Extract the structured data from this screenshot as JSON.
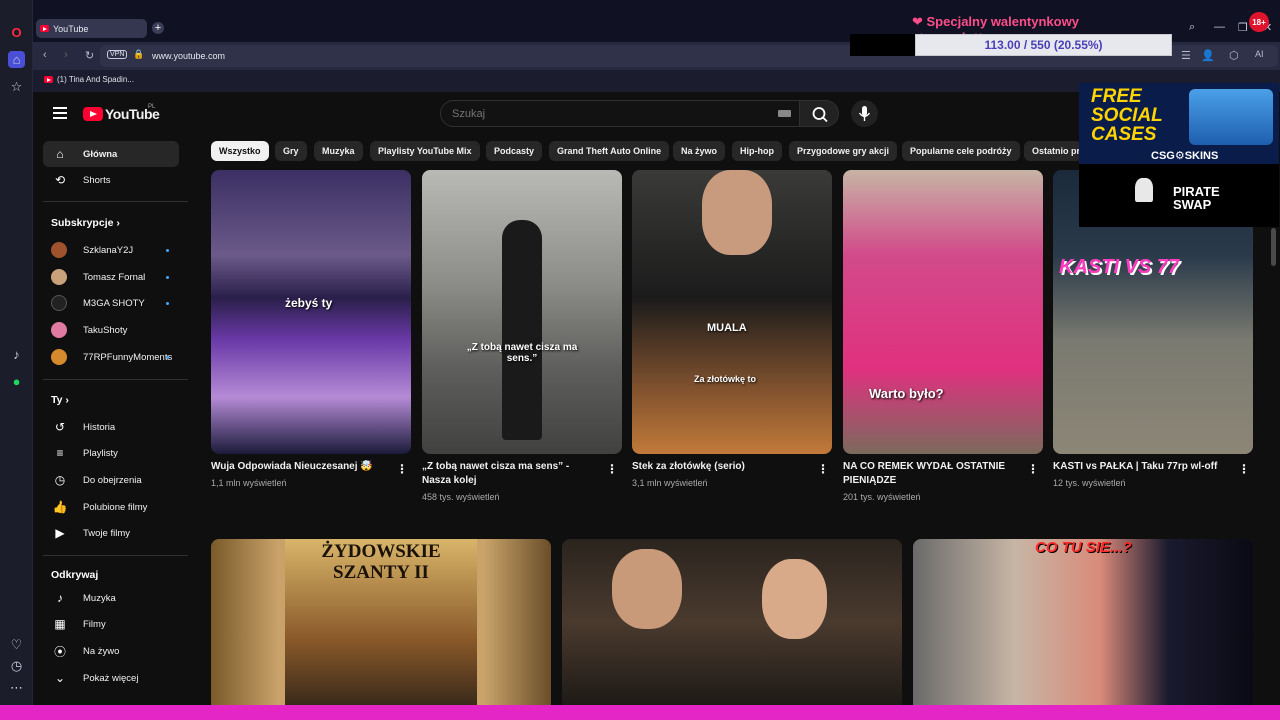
{
  "browser": {
    "tab_title": "YouTube",
    "url": "www.youtube.com",
    "vpn": "VPN",
    "bookmark": "(1) Tina And Spadin...",
    "ai_label": "AI"
  },
  "overlay": {
    "title": "❤ Specjalny walentynkowy streamek ❤",
    "progress": "113.00 / 550 (20.55%)",
    "progress_fraction": 0.2055,
    "badge": "18+"
  },
  "ads": {
    "ad1_line1": "FREE",
    "ad1_line2": "SOCIAL",
    "ad1_line3": "CASES",
    "ad1_brand": "CSG⚙SKINS",
    "ad2_line1": "PIRATE",
    "ad2_line2": "SWAP"
  },
  "youtube": {
    "logo": "YouTube",
    "region": "PL",
    "search_placeholder": "Szukaj"
  },
  "sidebar": {
    "main": [
      {
        "label": "Główna",
        "icon": "home-icon"
      },
      {
        "label": "Shorts",
        "icon": "shorts-icon"
      }
    ],
    "subs_title": "Subskrypcje",
    "subs": [
      {
        "label": "SzklanaY2J",
        "color": "#a0522d"
      },
      {
        "label": "Tomasz Fornal",
        "color": "#c9a27a"
      },
      {
        "label": "M3GA SHOTY",
        "color": "#222222"
      },
      {
        "label": "TakuShoty",
        "color": "#e07aa0"
      },
      {
        "label": "77RPFunnyMoments",
        "color": "#d68a2e"
      }
    ],
    "you_title": "Ty",
    "you": [
      {
        "label": "Historia",
        "icon": "history-icon"
      },
      {
        "label": "Playlisty",
        "icon": "playlist-icon"
      },
      {
        "label": "Do obejrzenia",
        "icon": "watch-later-icon"
      },
      {
        "label": "Polubione filmy",
        "icon": "like-icon"
      },
      {
        "label": "Twoje filmy",
        "icon": "your-videos-icon"
      }
    ],
    "explore_title": "Odkrywaj",
    "explore": [
      {
        "label": "Muzyka",
        "icon": "music-icon"
      },
      {
        "label": "Filmy",
        "icon": "film-icon"
      },
      {
        "label": "Na żywo",
        "icon": "live-icon"
      },
      {
        "label": "Pokaż więcej",
        "icon": "chevron-down-icon"
      }
    ]
  },
  "chips": [
    "Wszystko",
    "Gry",
    "Muzyka",
    "Playlisty YouTube Mix",
    "Podcasty",
    "Grand Theft Auto Online",
    "Na żywo",
    "Hip-hop",
    "Przygodowe gry akcji",
    "Popularne cele podróży",
    "Ostatnio pr"
  ],
  "videos": [
    {
      "title": "Wuja Odpowiada Nieuczesanej 🤯",
      "meta": "1,1 mln wyświetleń",
      "caption": "żebyś ty"
    },
    {
      "title_l1": "„Z tobą nawet cisza ma sens” -",
      "title_l2": "Nasza kolej",
      "meta": "458 tys. wyświetleń",
      "caption": "„Z tobą nawet cisza ma sens.”"
    },
    {
      "title": "Stek za złotówkę (serio)",
      "meta": "3,1 mln wyświetleń",
      "caption": "Za złotówkę to",
      "shirt": "MUALA"
    },
    {
      "title_l1": "NA CO REMEK WYDAŁ OSTATNIE",
      "title_l2": "PIENIĄDZE",
      "meta": "201 tys. wyświetleń",
      "caption": "Warto było?"
    },
    {
      "title": "KASTI vs PAŁKA | Taku 77rp wl-off",
      "meta": "12 tys. wyświetleń",
      "caption": "KASTI VS 77"
    }
  ],
  "row2": {
    "thumb1_text": "ŻYDOWSKIE SZANTY II",
    "thumb3_text": "CO TU SIE...?"
  }
}
